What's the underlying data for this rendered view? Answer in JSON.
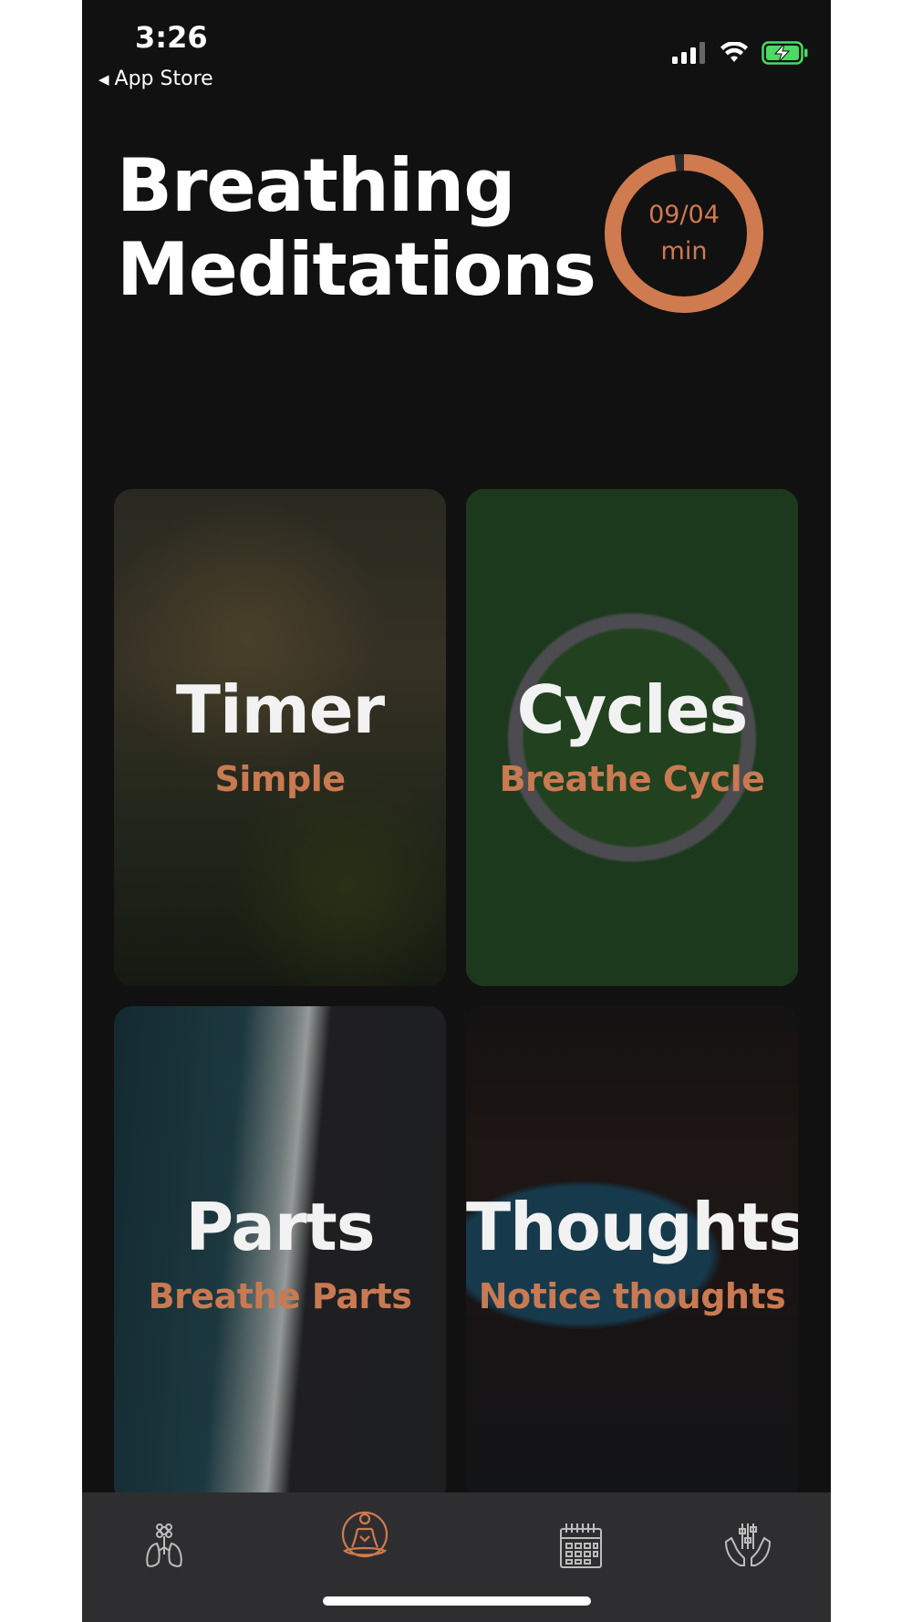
{
  "status_bar": {
    "time": "3:26",
    "back_label": "App Store",
    "back_icon": "triangle-left-icon",
    "icons": [
      "cellular-signal-icon",
      "wifi-icon",
      "battery-charging-icon"
    ]
  },
  "header": {
    "title_line1": "Breathing",
    "title_line2": "Meditations",
    "progress": {
      "value_text": "09/04",
      "unit": "min",
      "fraction": 0.98
    }
  },
  "cards": [
    {
      "title": "Timer",
      "subtitle": "Simple"
    },
    {
      "title": "Cycles",
      "subtitle": "Breathe Cycle"
    },
    {
      "title": "Parts",
      "subtitle": "Breathe Parts"
    },
    {
      "title": "Thoughts",
      "subtitle": "Notice thoughts"
    }
  ],
  "tab_bar": {
    "tabs": [
      {
        "icon": "lungs-flower-icon",
        "active": false
      },
      {
        "icon": "meditation-person-icon",
        "active": true
      },
      {
        "icon": "calendar-icon",
        "active": false
      },
      {
        "icon": "hands-sliders-icon",
        "active": false
      }
    ]
  },
  "colors": {
    "accent": "#cf7a4f",
    "background": "#111112",
    "tab_bar": "#2e2e30",
    "battery": "#4cd964"
  }
}
